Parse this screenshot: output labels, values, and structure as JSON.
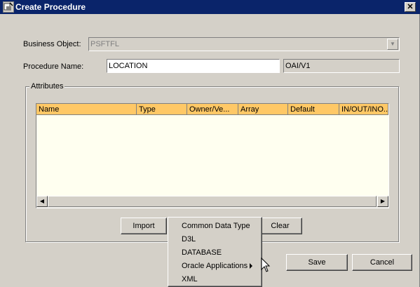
{
  "window": {
    "title": "Create Procedure",
    "close_glyph": "✕"
  },
  "form": {
    "business_object_label": "Business Object:",
    "business_object_value": "PSFTFL",
    "procedure_name_label": "Procedure Name:",
    "procedure_name_value": "LOCATION",
    "version_value": "OAI/V1"
  },
  "attributes": {
    "group_label": "Attributes",
    "columns": [
      "Name",
      "Type",
      "Owner/Ve...",
      "Array",
      "Default",
      "IN/OUT/INO..."
    ],
    "rows": []
  },
  "buttons": {
    "import": "Import",
    "clear": "Clear",
    "save": "Save",
    "cancel": "Cancel"
  },
  "import_menu": {
    "items": [
      "Common Data Type",
      "D3L",
      "DATABASE",
      "Oracle Applications",
      "XML"
    ]
  },
  "colors": {
    "titlebar": "#0a246a",
    "table_header": "#ffc866",
    "table_body": "#fffff0",
    "dialog": "#d4d0c8"
  }
}
